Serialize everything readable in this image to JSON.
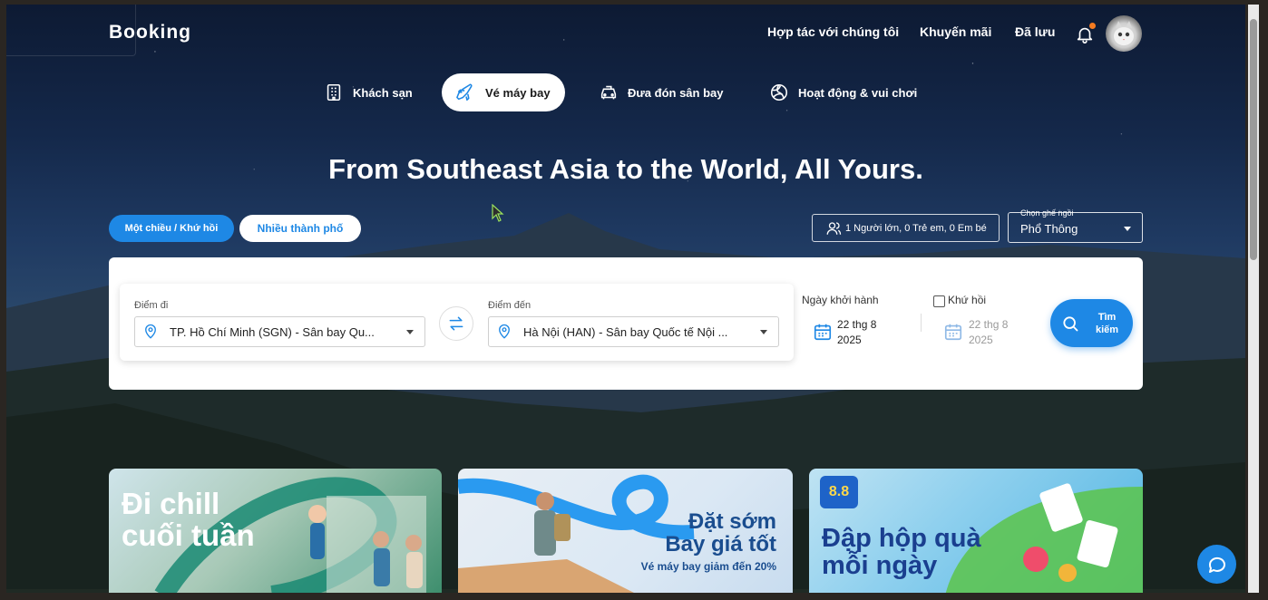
{
  "header": {
    "logo": "Booking",
    "nav": [
      "Hợp tác với chúng tôi",
      "Khuyến mãi",
      "Đã lưu"
    ]
  },
  "services": [
    {
      "label": "Khách sạn",
      "icon": "building-icon"
    },
    {
      "label": "Vé máy bay",
      "icon": "plane-icon",
      "active": true
    },
    {
      "label": "Đưa đón sân bay",
      "icon": "car-icon"
    },
    {
      "label": "Hoạt động & vui chơi",
      "icon": "ball-icon"
    }
  ],
  "hero": {
    "headline": "From Southeast Asia to the World, All Yours."
  },
  "trip_types": [
    "Một chiều / Khứ hồi",
    "Nhiều thành phố"
  ],
  "passengers": "1 Người lớn, 0 Trẻ em, 0 Em bé",
  "seat_class": {
    "label": "Chọn ghế ngồi",
    "value": "Phổ Thông"
  },
  "search": {
    "from_label": "Điểm đi",
    "from_value": "TP. Hồ Chí Minh (SGN) - Sân bay Qu...",
    "to_label": "Điểm đến",
    "to_value": "Hà Nội (HAN) - Sân bay Quốc tế Nội ...",
    "depart_label": "Ngày khởi hành",
    "depart_date_line1": "22 thg 8",
    "depart_date_line2": "2025",
    "return_label": "Khứ hồi",
    "return_date_line1": "22 thg 8",
    "return_date_line2": "2025",
    "button_line1": "Tìm",
    "button_line2": "kiếm"
  },
  "promos": [
    {
      "line1": "Đi chill",
      "line2": "cuối tuần"
    },
    {
      "line1": "Đặt sớm",
      "line2": "Bay giá tốt",
      "sub": "Vé máy bay giảm đến 20%"
    },
    {
      "badge": "8.8",
      "line1": "Đập hộp quà",
      "line2": "mỗi ngày"
    }
  ],
  "colors": {
    "accent": "#1e88e5",
    "notification": "#f47b20"
  }
}
